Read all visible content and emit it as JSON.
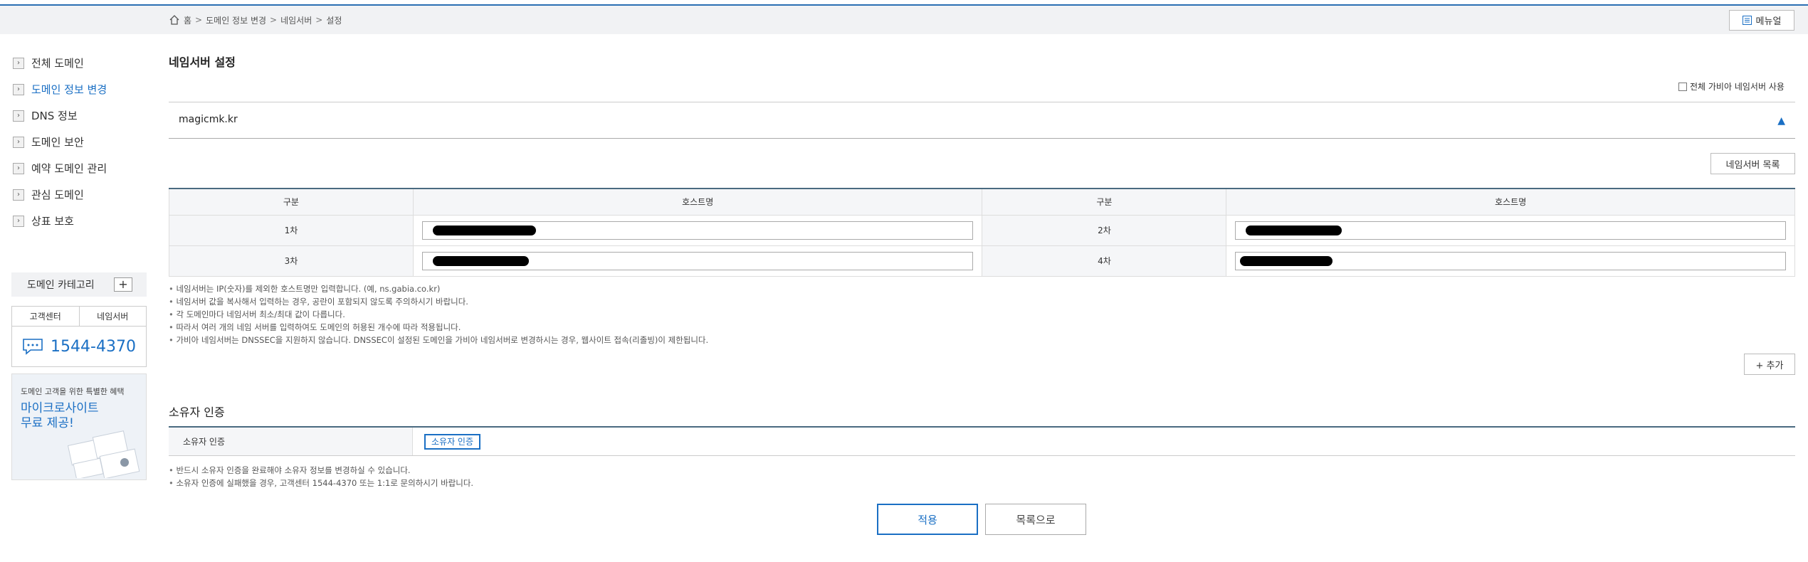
{
  "breadcrumb": {
    "home": "홈",
    "sep": ">",
    "items": [
      "도메인 정보 변경",
      "네임서버",
      "설정"
    ]
  },
  "header": {
    "manual_label": "메뉴얼"
  },
  "sidebar": {
    "items": [
      {
        "label": "전체 도메인",
        "active": false
      },
      {
        "label": "도메인 정보 변경",
        "active": true
      },
      {
        "label": "DNS 정보",
        "active": false
      },
      {
        "label": "도메인 보안",
        "active": false
      },
      {
        "label": "예약 도메인 관리",
        "active": false
      },
      {
        "label": "관심 도메인",
        "active": false
      },
      {
        "label": "상표 보호",
        "active": false
      }
    ],
    "category_label": "도메인 카테고리",
    "category_add": "+",
    "cs_tabs": [
      "고객센터",
      "네임서버"
    ],
    "cs_phone": "1544-4370",
    "promo_sub": "도메인 고객을 위한 특별한 혜택",
    "promo_main_1": "마이크로사이트",
    "promo_main_2": "무료 제공!"
  },
  "main": {
    "title": "네임서버 설정",
    "all_gabia_ns": "전체 가비아 네임서버 사용",
    "domain_name": "magicmk.kr",
    "toggle": "▲",
    "ns_list_button": "네임서버 목록",
    "table_headers": [
      "구분",
      "호스트명",
      "구분",
      "호스트명"
    ],
    "rows": [
      {
        "left_label": "1차",
        "right_label": "2차"
      },
      {
        "left_label": "3차",
        "right_label": "4차"
      }
    ],
    "notes": [
      "네임서버는 IP(숫자)를 제외한 호스트명만 입력합니다. (예, ns.gabia.co.kr)",
      "네임서버 값을 복사해서 입력하는 경우, 공란이 포함되지 않도록 주의하시기 바랍니다.",
      "각 도메인마다 네임서버 최소/최대 값이 다릅니다.",
      "따라서 여러 개의 네임 서버를 입력하여도 도메인의 허용된 개수에 따라 적용됩니다.",
      "가비아 네임서버는 DNSSEC을 지원하지 않습니다. DNSSEC이 설정된 도메인을 가비아 네임서버로 변경하시는 경우, 웹사이트 접속(리졸빙)이 제한됩니다."
    ],
    "add_button": "+ 추가"
  },
  "owner": {
    "title": "소유자 인증",
    "label": "소유자 인증",
    "button": "소유자 인증",
    "notes": [
      "반드시 소유자 인증을 완료해야 소유자 정보를 변경하실 수 있습니다.",
      "소유자 인증에 실패했을 경우, 고객센터 1544-4370 또는 1:1로 문의하시기 바랍니다."
    ]
  },
  "actions": {
    "apply": "적용",
    "back": "목록으로"
  },
  "colors": {
    "accent": "#1a6fc4",
    "top_line": "#2a6fb3",
    "table_border": "#4a6a80"
  }
}
